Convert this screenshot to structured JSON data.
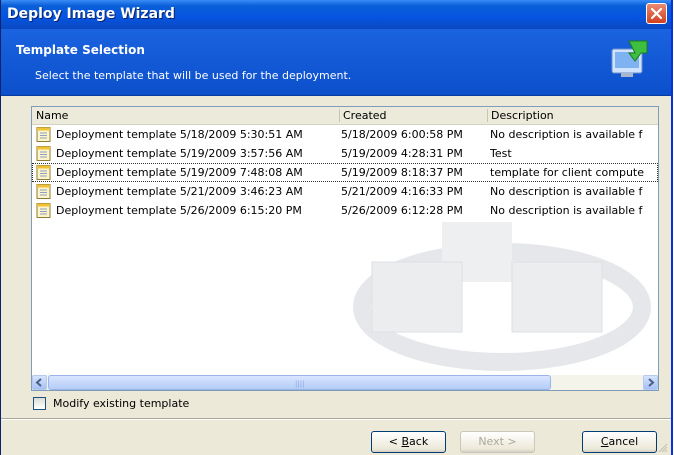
{
  "window": {
    "title": "Deploy Image Wizard"
  },
  "header": {
    "title": "Template Selection",
    "subtitle": "Select the template that will be used for the deployment."
  },
  "list": {
    "columns": [
      "Name",
      "Created",
      "Description"
    ],
    "rows": [
      {
        "name": "Deployment template 5/18/2009 5:30:51 AM",
        "created": "5/18/2009 6:00:58 PM",
        "description": "No description is available f"
      },
      {
        "name": "Deployment template 5/19/2009 3:57:56 AM",
        "created": "5/19/2009 4:28:31 PM",
        "description": "Test"
      },
      {
        "name": "Deployment template 5/19/2009 7:48:08 AM",
        "created": "5/19/2009 8:18:37 PM",
        "description": "template for client compute"
      },
      {
        "name": "Deployment template 5/21/2009 3:46:23 AM",
        "created": "5/21/2009 4:16:33 PM",
        "description": "No description is available f"
      },
      {
        "name": "Deployment template 5/26/2009 6:15:20 PM",
        "created": "5/26/2009 6:12:28 PM",
        "description": "No description is available f"
      }
    ]
  },
  "options": {
    "modify_label": "Modify existing template",
    "modify_checked": false
  },
  "buttons": {
    "back_prefix": "< ",
    "back_mnemonic": "B",
    "back_rest": "ack",
    "next_label": "Next >",
    "cancel_mnemonic": "C",
    "cancel_rest": "ancel"
  },
  "colors": {
    "title_bar": "#0554e0",
    "header_band": "#1058d8",
    "dialog_bg": "#ece9d8",
    "close_button": "#d2401f"
  },
  "icons": {
    "close": "close-icon",
    "header": "wizard-deploy-icon",
    "row": "template-document-icon"
  }
}
